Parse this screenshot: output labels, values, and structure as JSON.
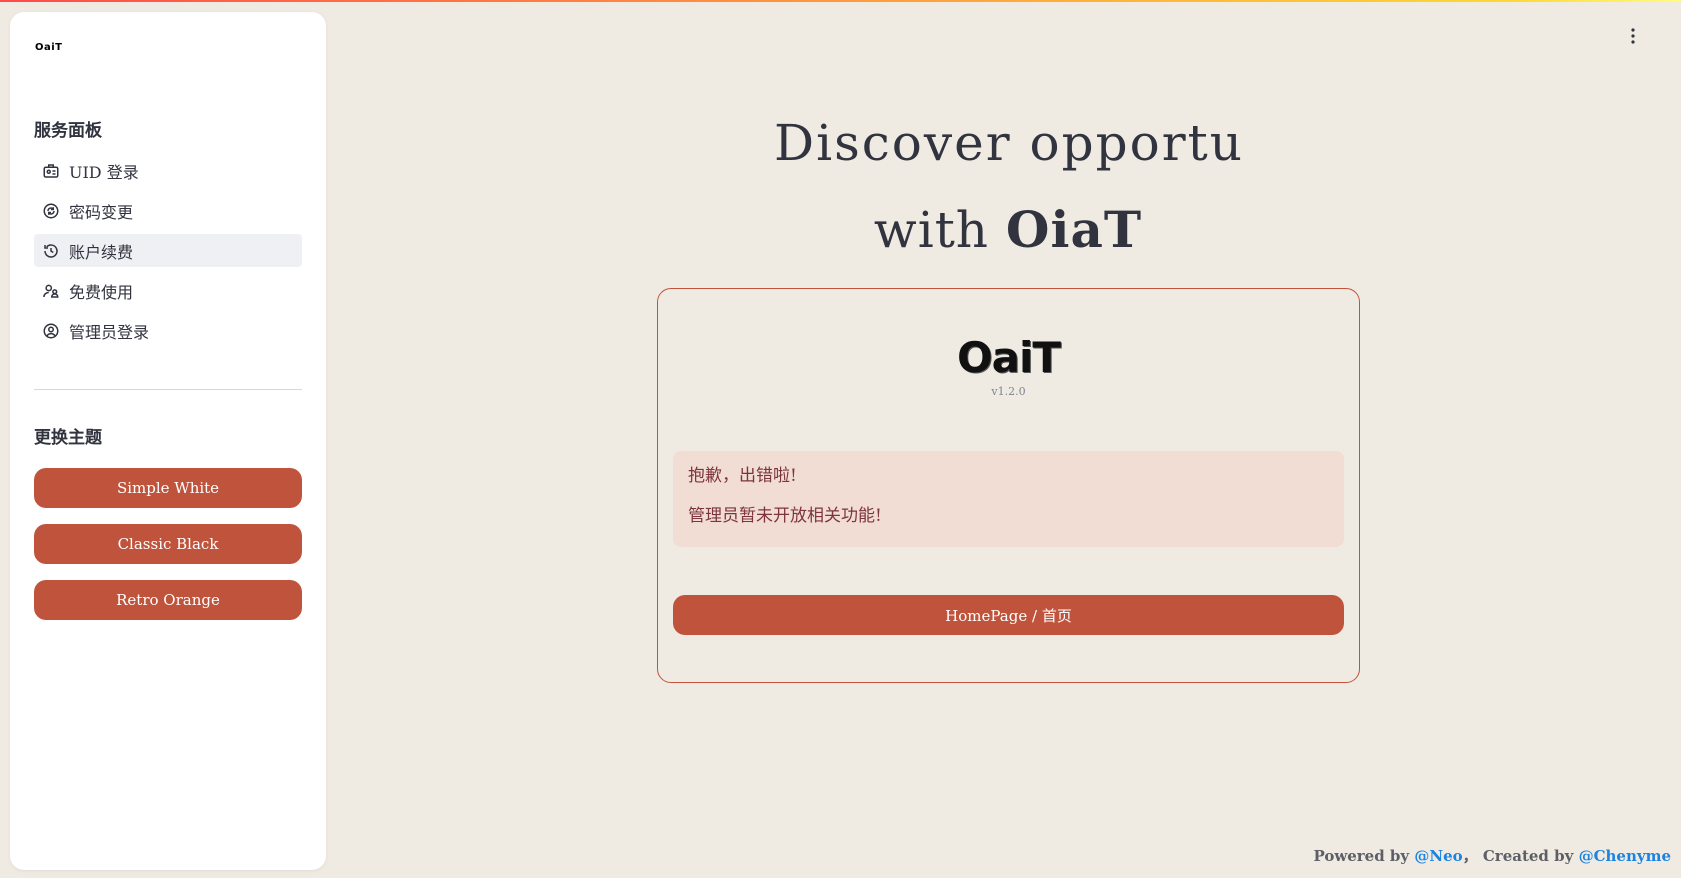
{
  "colors": {
    "accent": "#c0533c",
    "background": "#efebe3",
    "alert_bg": "#f1ddd4",
    "alert_text": "#7d353b",
    "link": "#1c83e1"
  },
  "sidebar": {
    "logo": "OaiT",
    "services_title": "服务面板",
    "items": [
      {
        "label": "UID 登录",
        "icon": "id-card-icon"
      },
      {
        "label": "密码变更",
        "icon": "refresh-key-icon"
      },
      {
        "label": "账户续费",
        "icon": "history-icon",
        "active": true
      },
      {
        "label": "免费使用",
        "icon": "user-group-icon"
      },
      {
        "label": "管理员登录",
        "icon": "account-circle-icon"
      }
    ],
    "theme_title": "更换主题",
    "themes": [
      "Simple White",
      "Classic Black",
      "Retro Orange"
    ]
  },
  "hero": {
    "line1": "Discover opportu",
    "line2_prefix": "with ",
    "line2_brand": "OiaT"
  },
  "card": {
    "logo": "OaiT",
    "version": "v1.2.0",
    "alert_title": "抱歉，出错啦!",
    "alert_message": "管理员暂未开放相关功能!",
    "home_button": "HomePage / 首页"
  },
  "footer": {
    "powered_prefix": "Powered by ",
    "powered_link": "@Neo",
    "created_prefix": "，  Created by ",
    "created_link": "@Chenyme"
  }
}
